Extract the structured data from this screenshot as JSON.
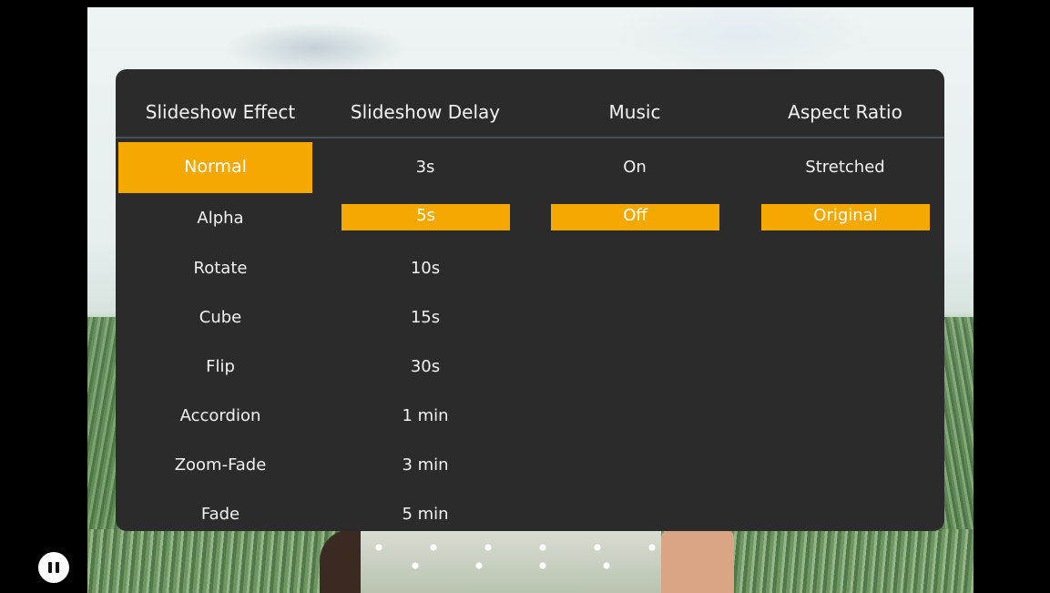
{
  "columns": [
    {
      "header": "Slideshow Effect",
      "selected_index": 0,
      "options": [
        "Normal",
        "Alpha",
        "Rotate",
        "Cube",
        "Flip",
        "Accordion",
        "Zoom-Fade",
        "Fade"
      ]
    },
    {
      "header": "Slideshow Delay",
      "selected_index": 1,
      "options": [
        "3s",
        "5s",
        "10s",
        "15s",
        "30s",
        "1 min",
        "3 min",
        "5 min"
      ]
    },
    {
      "header": "Music",
      "selected_index": 1,
      "options": [
        "On",
        "Off"
      ]
    },
    {
      "header": "Aspect Ratio",
      "selected_index": 1,
      "options": [
        "Stretched",
        "Original"
      ]
    }
  ],
  "colors": {
    "panel_bg": "#2b2b2b",
    "accent": "#f5a800",
    "divider": "#4a4e5c",
    "text": "#f2f2f2"
  },
  "icons": {
    "playback": "pause-icon"
  }
}
